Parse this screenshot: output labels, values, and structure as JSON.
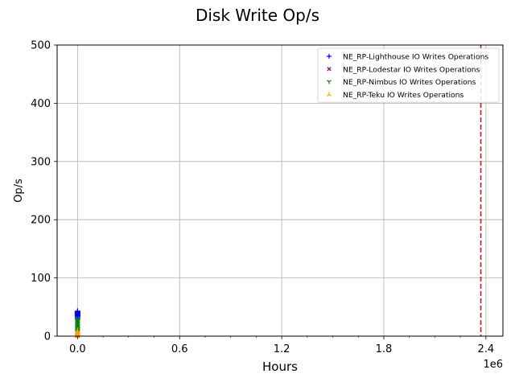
{
  "chart_data": {
    "type": "scatter",
    "title": "Disk Write Op/s",
    "xlabel": "Hours",
    "ylabel": "Op/s",
    "x_offset_label": "1e6",
    "xlim": [
      -120000,
      2500000
    ],
    "ylim": [
      0,
      500
    ],
    "x_scale": 1000000,
    "xticks": [
      0,
      600000,
      1200000,
      1800000,
      2400000
    ],
    "xtick_labels": [
      "0.0",
      "0.6",
      "1.2",
      "1.8",
      "2.4"
    ],
    "yticks": [
      0,
      100,
      200,
      300,
      400,
      500
    ],
    "ytick_labels": [
      "0",
      "100",
      "200",
      "300",
      "400",
      "500"
    ],
    "grid": true,
    "legend_position": "top-right",
    "vline": {
      "x": 2370000,
      "color": "#b22222",
      "style": "dashed"
    },
    "series": [
      {
        "name": "NE_RP-Lighthouse IO Writes Operations",
        "marker": "+",
        "color": "#0000ff",
        "x": [
          0,
          0,
          0,
          0,
          0,
          0,
          0,
          0,
          0,
          0,
          0,
          0
        ],
        "y": [
          30,
          32,
          34,
          35,
          36,
          37,
          38,
          39,
          40,
          41,
          42,
          43
        ]
      },
      {
        "name": "NE_RP-Lodestar IO Writes Operations",
        "marker": "x",
        "color": "#800080",
        "x": [
          0,
          0,
          0,
          0,
          0,
          0
        ],
        "y": [
          1,
          2,
          3,
          4,
          5,
          6
        ]
      },
      {
        "name": "NE_RP-Nimbus IO Writes Operations",
        "marker": "Y",
        "color": "#008000",
        "x": [
          0,
          0,
          0,
          0,
          0,
          0,
          0,
          0,
          0,
          0,
          0,
          0
        ],
        "y": [
          8,
          10,
          12,
          14,
          16,
          18,
          20,
          22,
          24,
          26,
          28,
          30
        ]
      },
      {
        "name": "NE_RP-Teku IO Writes Operations",
        "marker": "tri",
        "color": "#ffa500",
        "x": [
          0,
          0,
          0,
          0,
          0,
          0,
          0
        ],
        "y": [
          1,
          2,
          3,
          4,
          6,
          8,
          10
        ]
      }
    ]
  }
}
